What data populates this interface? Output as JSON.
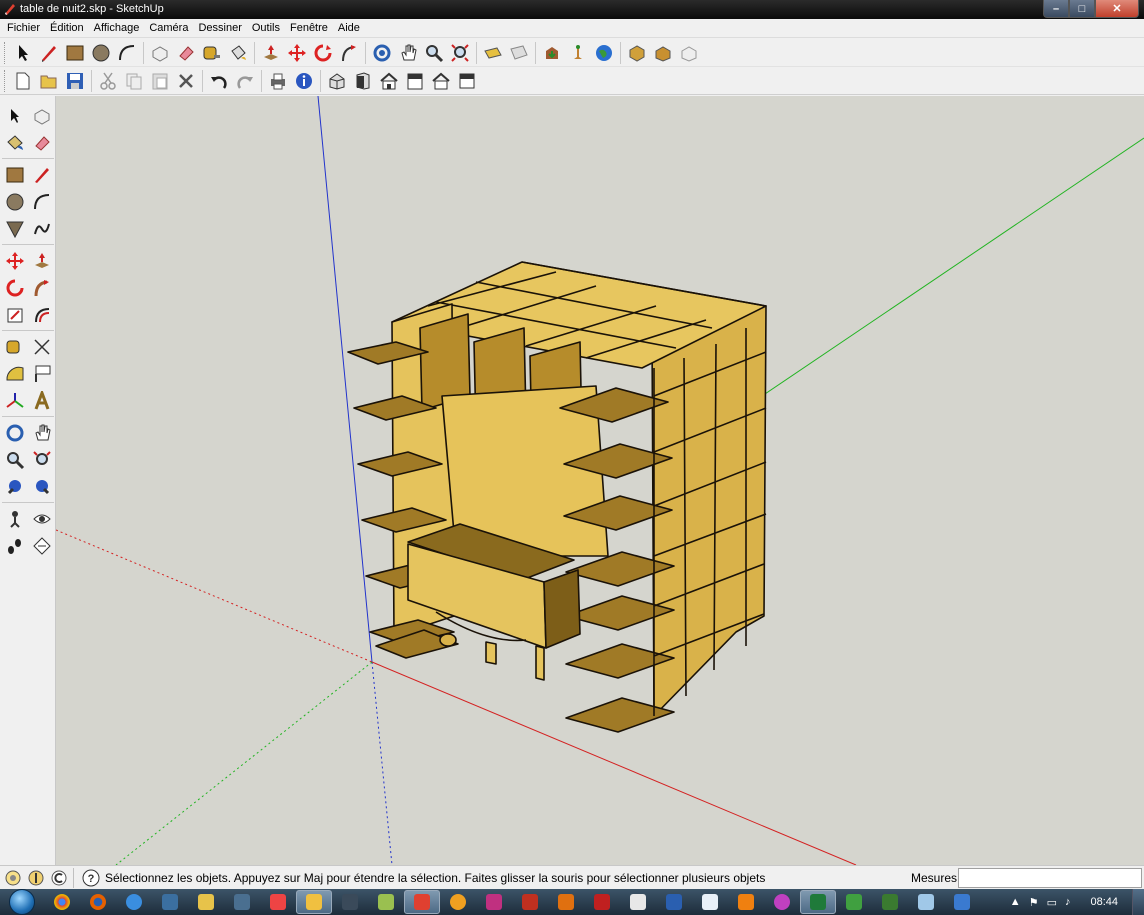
{
  "window": {
    "title": "table de nuit2.skp - SketchUp",
    "buttons": {
      "minimize": "–",
      "maximize": "□",
      "close": "✕"
    }
  },
  "menu": [
    "Fichier",
    "Édition",
    "Affichage",
    "Caméra",
    "Dessiner",
    "Outils",
    "Fenêtre",
    "Aide"
  ],
  "toolbar1": [
    "select-icon",
    "line-icon",
    "rectangle-icon",
    "circle-icon",
    "arc-icon",
    "make-component-icon",
    "eraser-icon",
    "tape-measure-icon",
    "paint-bucket-icon",
    "push-pull-icon",
    "move-icon",
    "rotate-icon",
    "follow-me-icon",
    "orbit-icon",
    "pan-icon",
    "zoom-icon",
    "zoom-extents-icon",
    "add-location-icon",
    "toggle-terrain-icon",
    "get-models-icon",
    "share-model-icon",
    "preview-google-earth-icon",
    "get-components-icon",
    "share-component-icon",
    "extension-icon"
  ],
  "toolbar2": [
    "new-icon",
    "open-icon",
    "save-icon",
    "cut-icon",
    "copy-icon",
    "paste-icon",
    "erase-icon",
    "undo-icon",
    "redo-icon",
    "print-icon",
    "model-info-icon",
    "iso-view-icon",
    "front-view-icon",
    "right-view-icon",
    "back-view-icon",
    "left-view-icon",
    "top-view-icon"
  ],
  "lefttools": [
    [
      "select-icon",
      "make-component-icon"
    ],
    [
      "paint-bucket-icon",
      "eraser-icon"
    ],
    [
      "rectangle-icon",
      "line-icon"
    ],
    [
      "circle-icon",
      "arc-icon"
    ],
    [
      "polygon-icon",
      "freehand-icon"
    ],
    [
      "move-icon",
      "push-pull-icon"
    ],
    [
      "rotate-icon",
      "follow-me-icon"
    ],
    [
      "scale-icon",
      "offset-icon"
    ],
    [
      "tape-measure-icon",
      "dimension-icon"
    ],
    [
      "protractor-icon",
      "text-icon"
    ],
    [
      "axes-icon",
      "3d-text-icon"
    ],
    [
      "orbit-icon",
      "pan-icon"
    ],
    [
      "zoom-icon",
      "zoom-window-icon"
    ],
    [
      "previous-view-icon",
      "next-view-icon"
    ],
    [
      "position-camera-icon",
      "look-around-icon"
    ],
    [
      "walk-icon",
      "section-plane-icon"
    ]
  ],
  "status": {
    "text": "Sélectionnez les objets. Appuyez sur Maj pour étendre la sélection. Faites glisser la souris pour sélectionner plusieurs objets",
    "mesures_label": "Mesures",
    "mesures_value": ""
  },
  "colors": {
    "viewport_bg": "#d5d5ce",
    "wood_top": "#cfa33a",
    "wood_front": "#e7c65f",
    "wood_dark": "#9c7620",
    "axis_red": "#d42222",
    "axis_green": "#22b422",
    "axis_blue": "#2233cc"
  },
  "taskbar": {
    "apps": [
      "chrome-icon",
      "firefox-icon",
      "ie-icon",
      "explorer-icon",
      "folder-icon",
      "media-icon",
      "rss-icon",
      "sketchup-icon",
      "mouse-icon",
      "app-icon",
      "sketchup-active-icon",
      "app2-icon",
      "indesign-icon",
      "filezilla-flame-icon",
      "illustrator-icon",
      "filezilla-icon",
      "acrobat-icon",
      "word-icon",
      "notepad-icon",
      "vlc-icon",
      "abc-icon",
      "excel-icon",
      "green-app-icon",
      "dreamweaver-icon",
      "notes-icon",
      "app3-icon"
    ],
    "clock": "08:44"
  }
}
